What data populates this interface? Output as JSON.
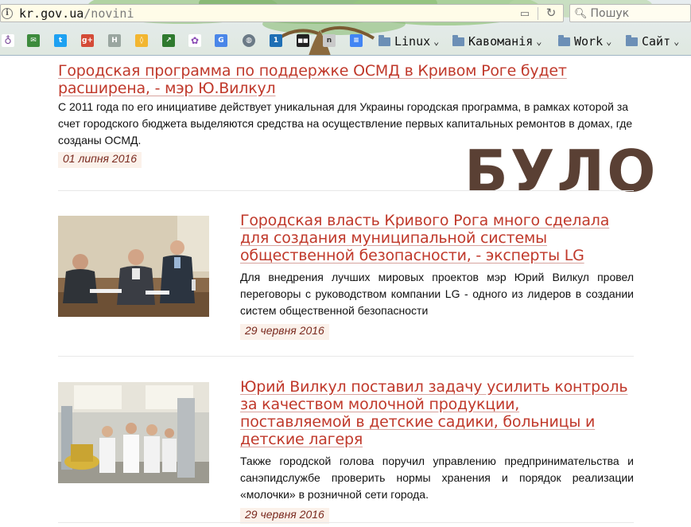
{
  "browser": {
    "url_host": "kr.gov.ua",
    "url_path": "/novini",
    "search_placeholder": "Пошук",
    "bookmarks": {
      "icons": [
        "tor-icon",
        "mail-icon",
        "twitter-icon",
        "google-plus-icon",
        "h-icon",
        "lightbulb-icon",
        "arrow-icon",
        "puzzle-icon",
        "translate-icon",
        "globe-icon",
        "calendar-icon",
        "dark-icon",
        "n-icon",
        "docs-icon"
      ],
      "calendar_day": "1",
      "folders": [
        "Linux",
        "Кавоманія",
        "Work",
        "Сайт"
      ]
    }
  },
  "stamp": {
    "text": "БУЛО",
    "color": "#5a4034"
  },
  "news": [
    {
      "title": "Городская программа по поддержке ОСМД в Кривом Роге будет расширена, - мэр Ю.Вилкул",
      "text": "С 2011 года по его инициативе действует уникальная для Украины городская программа, в рамках которой за счет городского бюджета выделяются средства на осуществление первых капитальных ремонтов в домах, где созданы ОСМД.",
      "date": "01 липня 2016"
    },
    {
      "title": "Городская власть Кривого Рога много сделала для создания муниципальной системы общественной безопасности, - эксперты LG",
      "text": "Для внедрения лучших мировых проектов мэр Юрий Вилкул провел переговоры с руководством компании LG - одного из лидеров в создании систем общественной безопасности",
      "date": "29 червня 2016"
    },
    {
      "title": "Юрий Вилкул поставил задачу усилить контроль за качеством молочной продукции, поставляемой в детские садики, больницы и детские лагеря",
      "text": "Также городской голова поручил управлению предпринимательства и санэпидслужбе проверить нормы хранения и порядок реализации «молочки» в розничной сети города.",
      "date": "29 червня 2016"
    }
  ],
  "colors": {
    "title": "#c0392b",
    "date_bg": "#fbf1ea",
    "date_text": "#7a2a1f"
  }
}
